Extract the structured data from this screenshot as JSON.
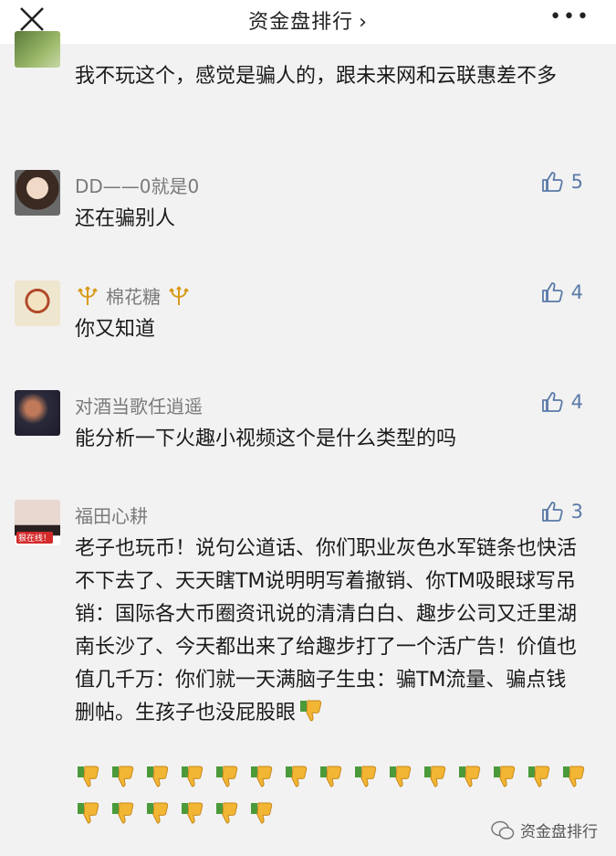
{
  "header": {
    "title": "资金盘排行",
    "chevron": "›",
    "more": "•••",
    "close_icon": "close-icon"
  },
  "comments": [
    {
      "name": "",
      "likes": "",
      "text": "我不玩这个，感觉是骗人的，跟未来网和云联惠差不多"
    },
    {
      "name": "DD——0就是0",
      "likes": "5",
      "text": "还在骗别人"
    },
    {
      "name": "棉花糖",
      "likes": "4",
      "text": "你又知道"
    },
    {
      "name": "对酒当歌任逍遥",
      "likes": "4",
      "text": "能分析一下火趣小视频这个是什么类型的吗"
    },
    {
      "name": "福田心耕",
      "likes": "3",
      "text": "老子也玩币！说句公道话、你们职业灰色水军链条也快活不下去了、天天瞎TM说明明写着撤销、你TM吸眼球写吊销：国际各大币圈资讯说的清清白白、趣步公司又迁里湖南长沙了、今天都出来了给趣步打了一个活广告！价值也值几千万：你们就一天满脑子生虫：骗TM流量、骗点钱删帖。生孩子也没屁股眼",
      "avatar_badge": "狠在线！"
    }
  ],
  "emoji": {
    "name": "thumbs-down-emoji",
    "inline_count": 1,
    "row1_count": 15,
    "row2_count": 6
  },
  "watermark": {
    "text": "资金盘排行"
  }
}
